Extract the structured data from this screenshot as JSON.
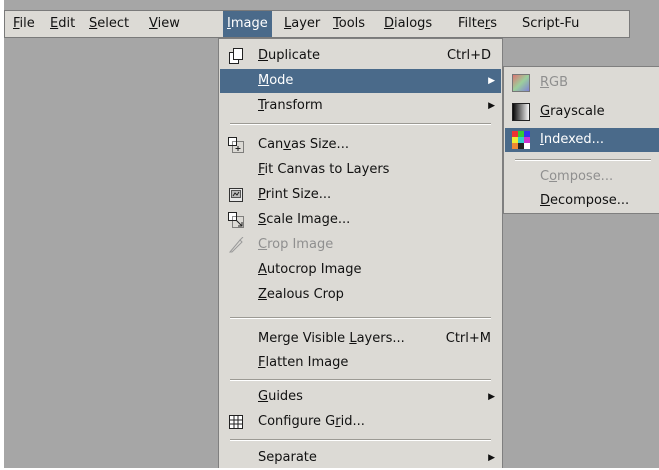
{
  "menubar": {
    "items": [
      {
        "pre": "",
        "u": "F",
        "post": "ile"
      },
      {
        "pre": "",
        "u": "E",
        "post": "dit"
      },
      {
        "pre": "",
        "u": "S",
        "post": "elect"
      },
      {
        "pre": "",
        "u": "V",
        "post": "iew"
      },
      {
        "pre": "",
        "u": "I",
        "post": "mage"
      },
      {
        "pre": "",
        "u": "L",
        "post": "ayer"
      },
      {
        "pre": "",
        "u": "T",
        "post": "ools"
      },
      {
        "pre": "",
        "u": "D",
        "post": "ialogs"
      },
      {
        "pre": "Filte",
        "u": "r",
        "post": "s"
      },
      {
        "pre": "Script-Fu",
        "u": "",
        "post": ""
      }
    ]
  },
  "image_menu": {
    "duplicate": {
      "pre": "",
      "u": "D",
      "post": "uplicate",
      "accel": "Ctrl+D"
    },
    "mode": {
      "pre": "",
      "u": "M",
      "post": "ode"
    },
    "transform": {
      "pre": "",
      "u": "T",
      "post": "ransform"
    },
    "canvas_size": {
      "pre": "Can",
      "u": "v",
      "post": "as Size..."
    },
    "fit_canvas": {
      "pre": "",
      "u": "F",
      "post": "it Canvas to Layers"
    },
    "print_size": {
      "pre": "",
      "u": "P",
      "post": "rint Size..."
    },
    "scale_image": {
      "pre": "",
      "u": "S",
      "post": "cale Image..."
    },
    "crop_image": {
      "pre": "",
      "u": "C",
      "post": "rop Image"
    },
    "autocrop": {
      "pre": "",
      "u": "A",
      "post": "utocrop Image"
    },
    "zealous": {
      "pre": "",
      "u": "Z",
      "post": "ealous Crop"
    },
    "merge": {
      "pre": "Merge Visible ",
      "u": "L",
      "post": "ayers...",
      "accel": "Ctrl+M"
    },
    "flatten": {
      "pre": "",
      "u": "F",
      "post": "latten Image"
    },
    "guides": {
      "pre": "",
      "u": "G",
      "post": "uides"
    },
    "configure_grid": {
      "pre": "Configure G",
      "u": "r",
      "post": "id..."
    },
    "separate": {
      "pre": "Separate",
      "u": "",
      "post": ""
    }
  },
  "mode_menu": {
    "rgb": {
      "pre": "",
      "u": "R",
      "post": "GB"
    },
    "grayscale": {
      "pre": "",
      "u": "G",
      "post": "rayscale"
    },
    "indexed": {
      "pre": "",
      "u": "I",
      "post": "ndexed..."
    },
    "compose": {
      "pre": "C",
      "u": "o",
      "post": "mpose..."
    },
    "decompose": {
      "pre": "",
      "u": "D",
      "post": "ecompose..."
    }
  },
  "colors": {
    "highlight": "#4a6a8a",
    "menu_bg": "#dcdad5",
    "canvas_bg": "#a6a6a6",
    "disabled_text": "#8f8f8f"
  }
}
